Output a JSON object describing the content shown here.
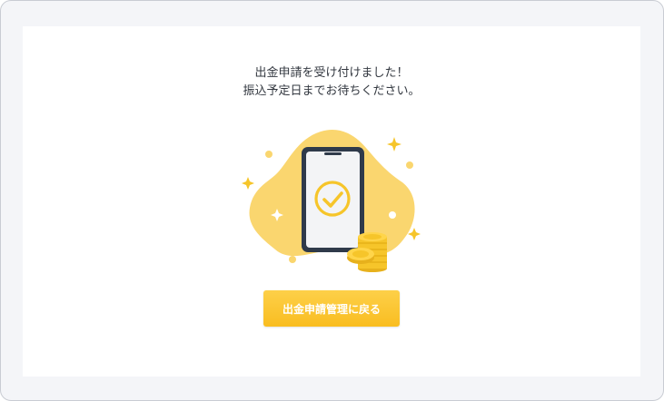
{
  "message": {
    "line1": "出金申請を受け付けました！",
    "line2": "振込予定日までお待ちください。"
  },
  "illustration": {
    "icons": [
      "phone-icon",
      "check-icon",
      "coin-stack-icon",
      "sparkle-icon"
    ]
  },
  "actions": {
    "back_label": "出金申請管理に戻る"
  },
  "colors": {
    "accent": "#f9c32c",
    "blob": "#fad66f",
    "phone_frame": "#2f3a4a",
    "coin": "#f6c52a",
    "page_background": "#f4f5f8"
  }
}
